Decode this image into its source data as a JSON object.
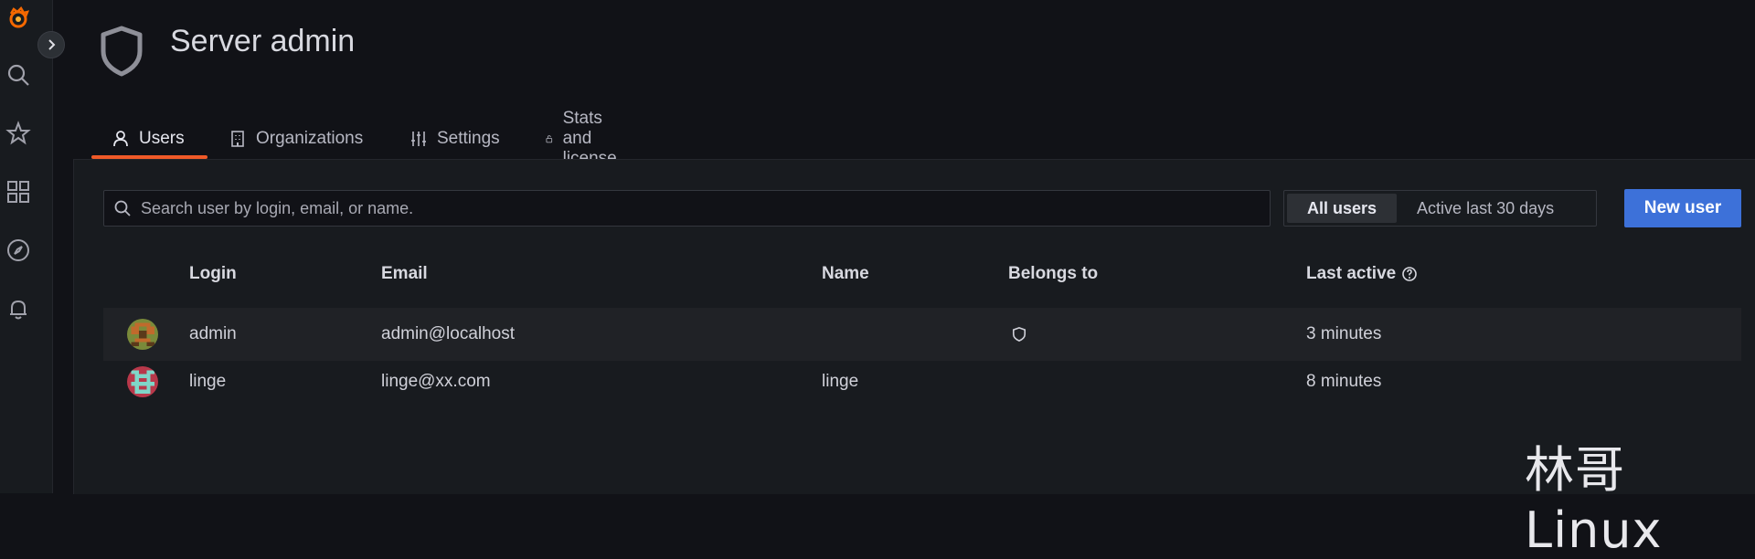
{
  "header": {
    "title": "Server admin"
  },
  "tabs": [
    {
      "label": "Users",
      "icon": "user-icon"
    },
    {
      "label": "Organizations",
      "icon": "building-icon"
    },
    {
      "label": "Settings",
      "icon": "sliders-icon"
    },
    {
      "label": "Stats and license",
      "icon": "lock-icon"
    }
  ],
  "search": {
    "placeholder": "Search user by login, email, or name.",
    "value": ""
  },
  "filter": {
    "options": [
      "All users",
      "Active last 30 days"
    ],
    "selected": "All users"
  },
  "actions": {
    "new_user_label": "New user"
  },
  "table": {
    "columns": [
      "Login",
      "Email",
      "Name",
      "Belongs to",
      "Last active"
    ],
    "rows": [
      {
        "login": "admin",
        "email": "admin@localhost",
        "name": "",
        "belongs_to_icon": "shield-icon",
        "last_active": "3 minutes"
      },
      {
        "login": "linge",
        "email": "linge@xx.com",
        "name": "linge",
        "belongs_to_icon": "",
        "last_active": "8 minutes"
      }
    ]
  },
  "watermark": "林哥Linux",
  "colors": {
    "accent": "#f05a28",
    "primary": "#3d71d9",
    "background": "#111217"
  }
}
